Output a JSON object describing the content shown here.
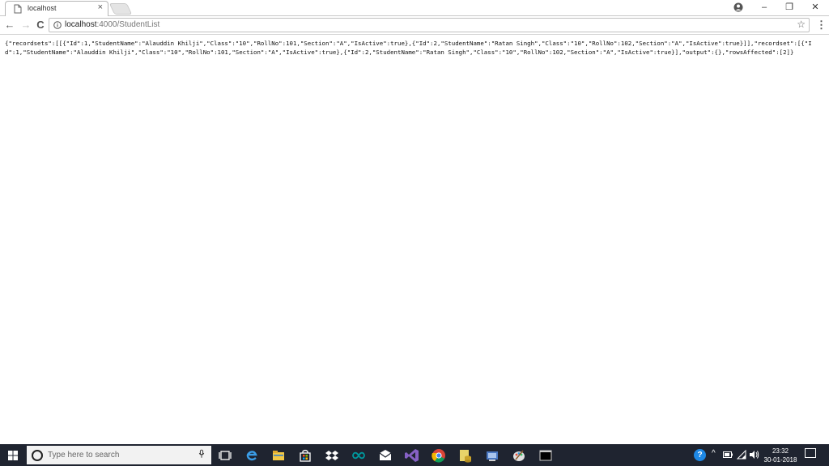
{
  "browser": {
    "tab_title": "localhost",
    "tab_close": "×",
    "url_host": "localhost",
    "url_path": ":4000/StudentList",
    "back": "←",
    "forward": "→",
    "reload": "C",
    "star": "☆",
    "menu": "⋮",
    "window_buttons": {
      "minimize": "–",
      "restore": "❐",
      "close": "✕"
    }
  },
  "page": {
    "json_text": "{\"recordsets\":[[{\"Id\":1,\"StudentName\":\"Alauddin Khilji\",\"Class\":\"10\",\"RollNo\":101,\"Section\":\"A\",\"IsActive\":true},{\"Id\":2,\"StudentName\":\"Ratan Singh\",\"Class\":\"10\",\"RollNo\":102,\"Section\":\"A\",\"IsActive\":true}]],\"recordset\":[{\"Id\":1,\"StudentName\":\"Alauddin Khilji\",\"Class\":\"10\",\"RollNo\":101,\"Section\":\"A\",\"IsActive\":true},{\"Id\":2,\"StudentName\":\"Ratan Singh\",\"Class\":\"10\",\"RollNo\":102,\"Section\":\"A\",\"IsActive\":true}],\"output\":{},\"rowsAffected\":[2]}"
  },
  "taskbar": {
    "search_placeholder": "Type here to search",
    "clock_time": "23:32",
    "clock_date": "30-01-2018",
    "help_glyph": "?",
    "icons": [
      "task-view-icon",
      "edge-icon",
      "file-explorer-icon",
      "store-icon",
      "dropbox-icon",
      "arduino-icon",
      "mail-icon",
      "visual-studio-icon",
      "chrome-icon",
      "sql-icon",
      "database-icon",
      "paint-icon",
      "terminal-icon"
    ]
  },
  "colors": {
    "taskbar_bg": "#1f2430",
    "active_underline": "#76b9ed"
  }
}
